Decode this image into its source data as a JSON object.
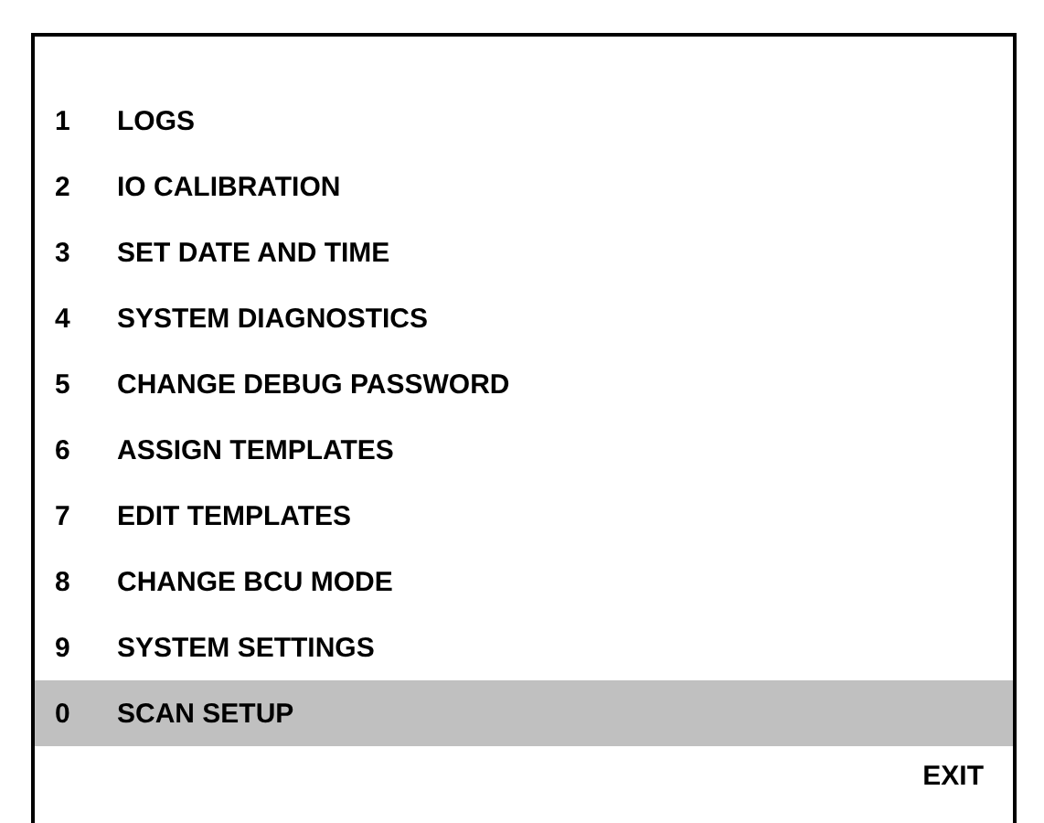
{
  "menu": {
    "items": [
      {
        "number": "1",
        "label": "LOGS",
        "selected": false
      },
      {
        "number": "2",
        "label": "IO CALIBRATION",
        "selected": false
      },
      {
        "number": "3",
        "label": "SET DATE AND TIME",
        "selected": false
      },
      {
        "number": "4",
        "label": "SYSTEM DIAGNOSTICS",
        "selected": false
      },
      {
        "number": "5",
        "label": "CHANGE DEBUG PASSWORD",
        "selected": false
      },
      {
        "number": "6",
        "label": "ASSIGN TEMPLATES",
        "selected": false
      },
      {
        "number": "7",
        "label": "EDIT TEMPLATES",
        "selected": false
      },
      {
        "number": "8",
        "label": "CHANGE BCU MODE",
        "selected": false
      },
      {
        "number": "9",
        "label": "SYSTEM SETTINGS",
        "selected": false
      },
      {
        "number": "0",
        "label": "SCAN SETUP",
        "selected": true
      }
    ]
  },
  "exit_button": {
    "label": "EXIT"
  }
}
